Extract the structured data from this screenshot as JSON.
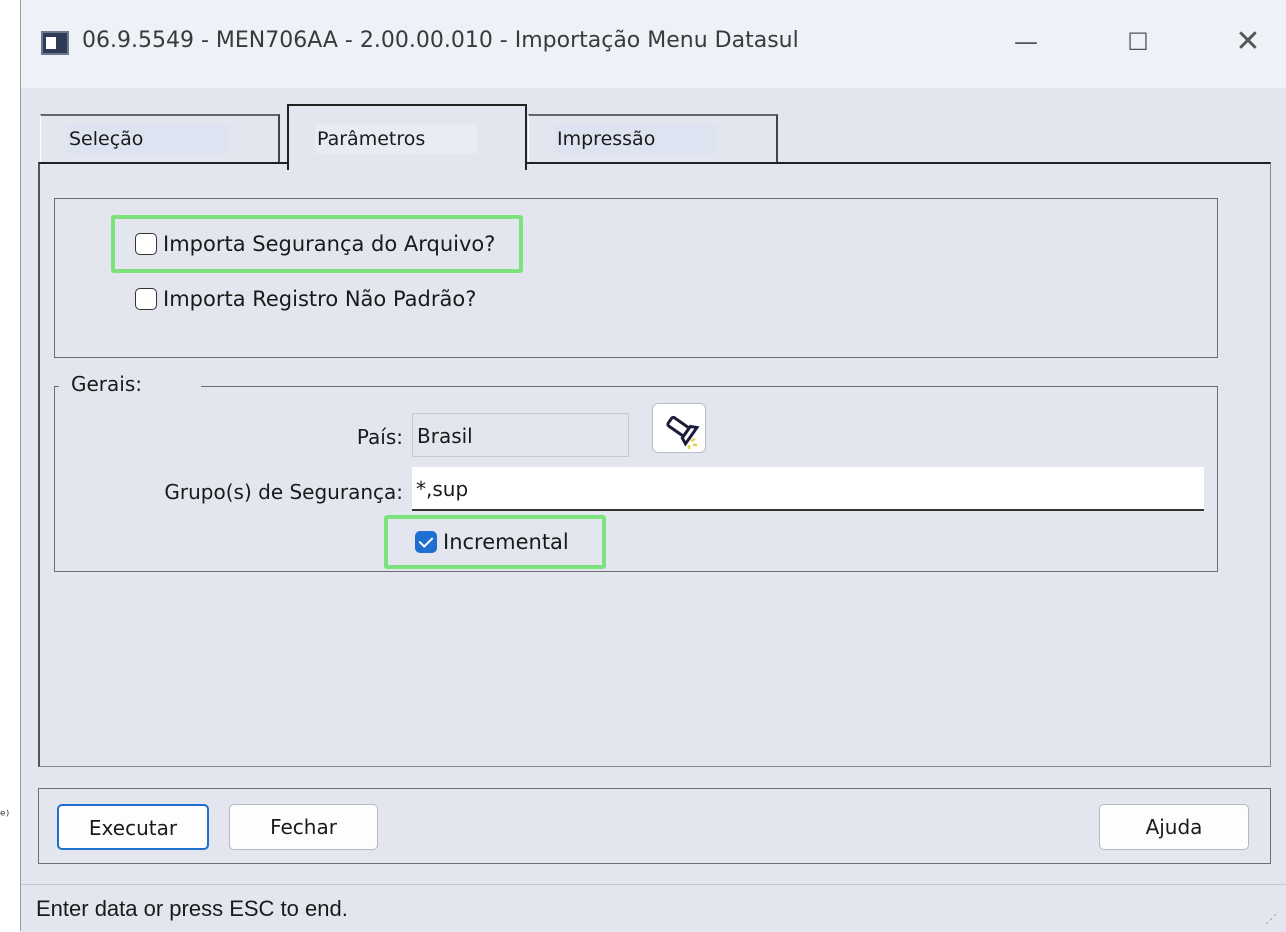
{
  "window": {
    "title": "06.9.5549 - MEN706AA - 2.00.00.010 - Importação Menu Datasul",
    "controls": {
      "minimize": "—",
      "maximize": "☐",
      "close": "✕"
    }
  },
  "tabs": [
    {
      "label": "Seleção",
      "active": false
    },
    {
      "label": "Parâmetros",
      "active": true
    },
    {
      "label": "Impressão",
      "active": false
    }
  ],
  "options": {
    "importa_seguranca": {
      "label": "Importa Segurança do Arquivo?",
      "checked": false
    },
    "importa_registro": {
      "label": "Importa Registro Não Padrão?",
      "checked": false
    }
  },
  "gerais": {
    "legend": "Gerais:",
    "pais_label": "País:",
    "pais_value": "Brasil",
    "grupo_label": "Grupo(s) de Segurança:",
    "grupo_value": "*,sup",
    "incremental": {
      "label": "Incremental",
      "checked": true
    }
  },
  "buttons": {
    "executar": "Executar",
    "fechar": "Fechar",
    "ajuda": "Ajuda"
  },
  "status": {
    "text": "Enter data or press ESC to end."
  },
  "edge_text": "ᵉ⁾",
  "colors": {
    "highlight": "#7ce27c",
    "accent": "#1e6fd0",
    "background": "#e3e6ef"
  }
}
